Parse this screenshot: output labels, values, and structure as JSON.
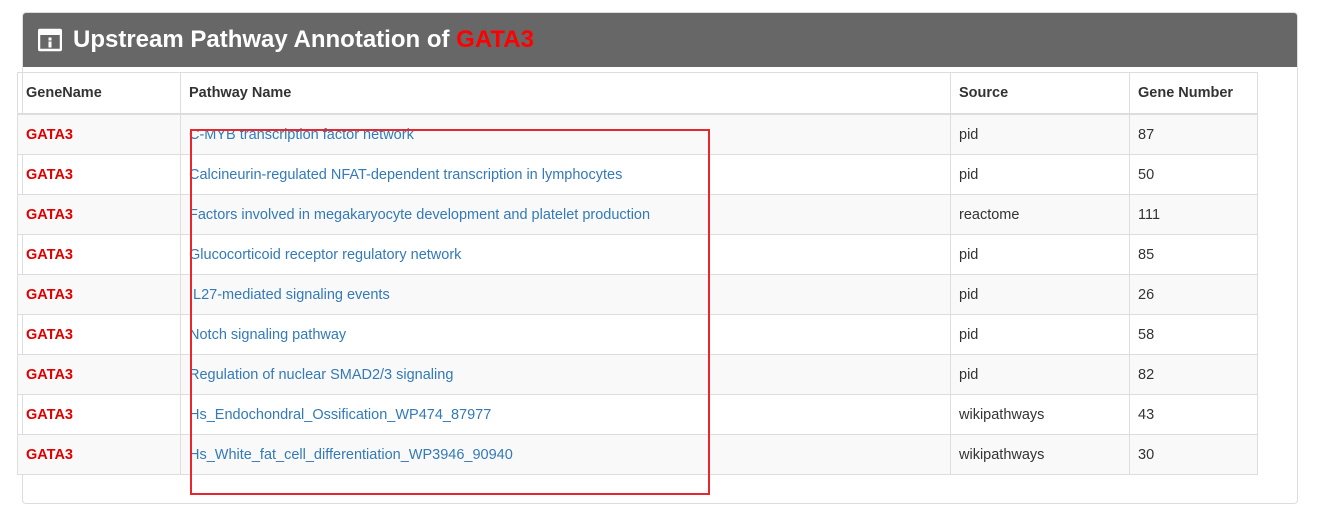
{
  "panel": {
    "title_prefix": "Upstream Pathway Annotation of",
    "title_gene": "GATA3",
    "icon": "info-box-icon"
  },
  "table": {
    "headers": [
      "GeneName",
      "Pathway Name",
      "Source",
      "Gene Number"
    ],
    "rows": [
      {
        "gene": "GATA3",
        "pathway": "C-MYB transcription factor network",
        "source": "pid",
        "count": "87"
      },
      {
        "gene": "GATA3",
        "pathway": "Calcineurin-regulated NFAT-dependent transcription in lymphocytes",
        "source": "pid",
        "count": "50"
      },
      {
        "gene": "GATA3",
        "pathway": "Factors involved in megakaryocyte development and platelet production",
        "source": "reactome",
        "count": "111"
      },
      {
        "gene": "GATA3",
        "pathway": "Glucocorticoid receptor regulatory network",
        "source": "pid",
        "count": "85"
      },
      {
        "gene": "GATA3",
        "pathway": "IL27-mediated signaling events",
        "source": "pid",
        "count": "26"
      },
      {
        "gene": "GATA3",
        "pathway": "Notch signaling pathway",
        "source": "pid",
        "count": "58"
      },
      {
        "gene": "GATA3",
        "pathway": "Regulation of nuclear SMAD2/3 signaling",
        "source": "pid",
        "count": "82"
      },
      {
        "gene": "GATA3",
        "pathway": "Hs_Endochondral_Ossification_WP474_87977",
        "source": "wikipathways",
        "count": "43"
      },
      {
        "gene": "GATA3",
        "pathway": "Hs_White_fat_cell_differentiation_WP3946_90940",
        "source": "wikipathways",
        "count": "30"
      }
    ]
  },
  "colors": {
    "heading_bg": "#676767",
    "gene_red": "#e00000",
    "link_blue": "#337ab7",
    "highlight_red": "#e8262e"
  }
}
